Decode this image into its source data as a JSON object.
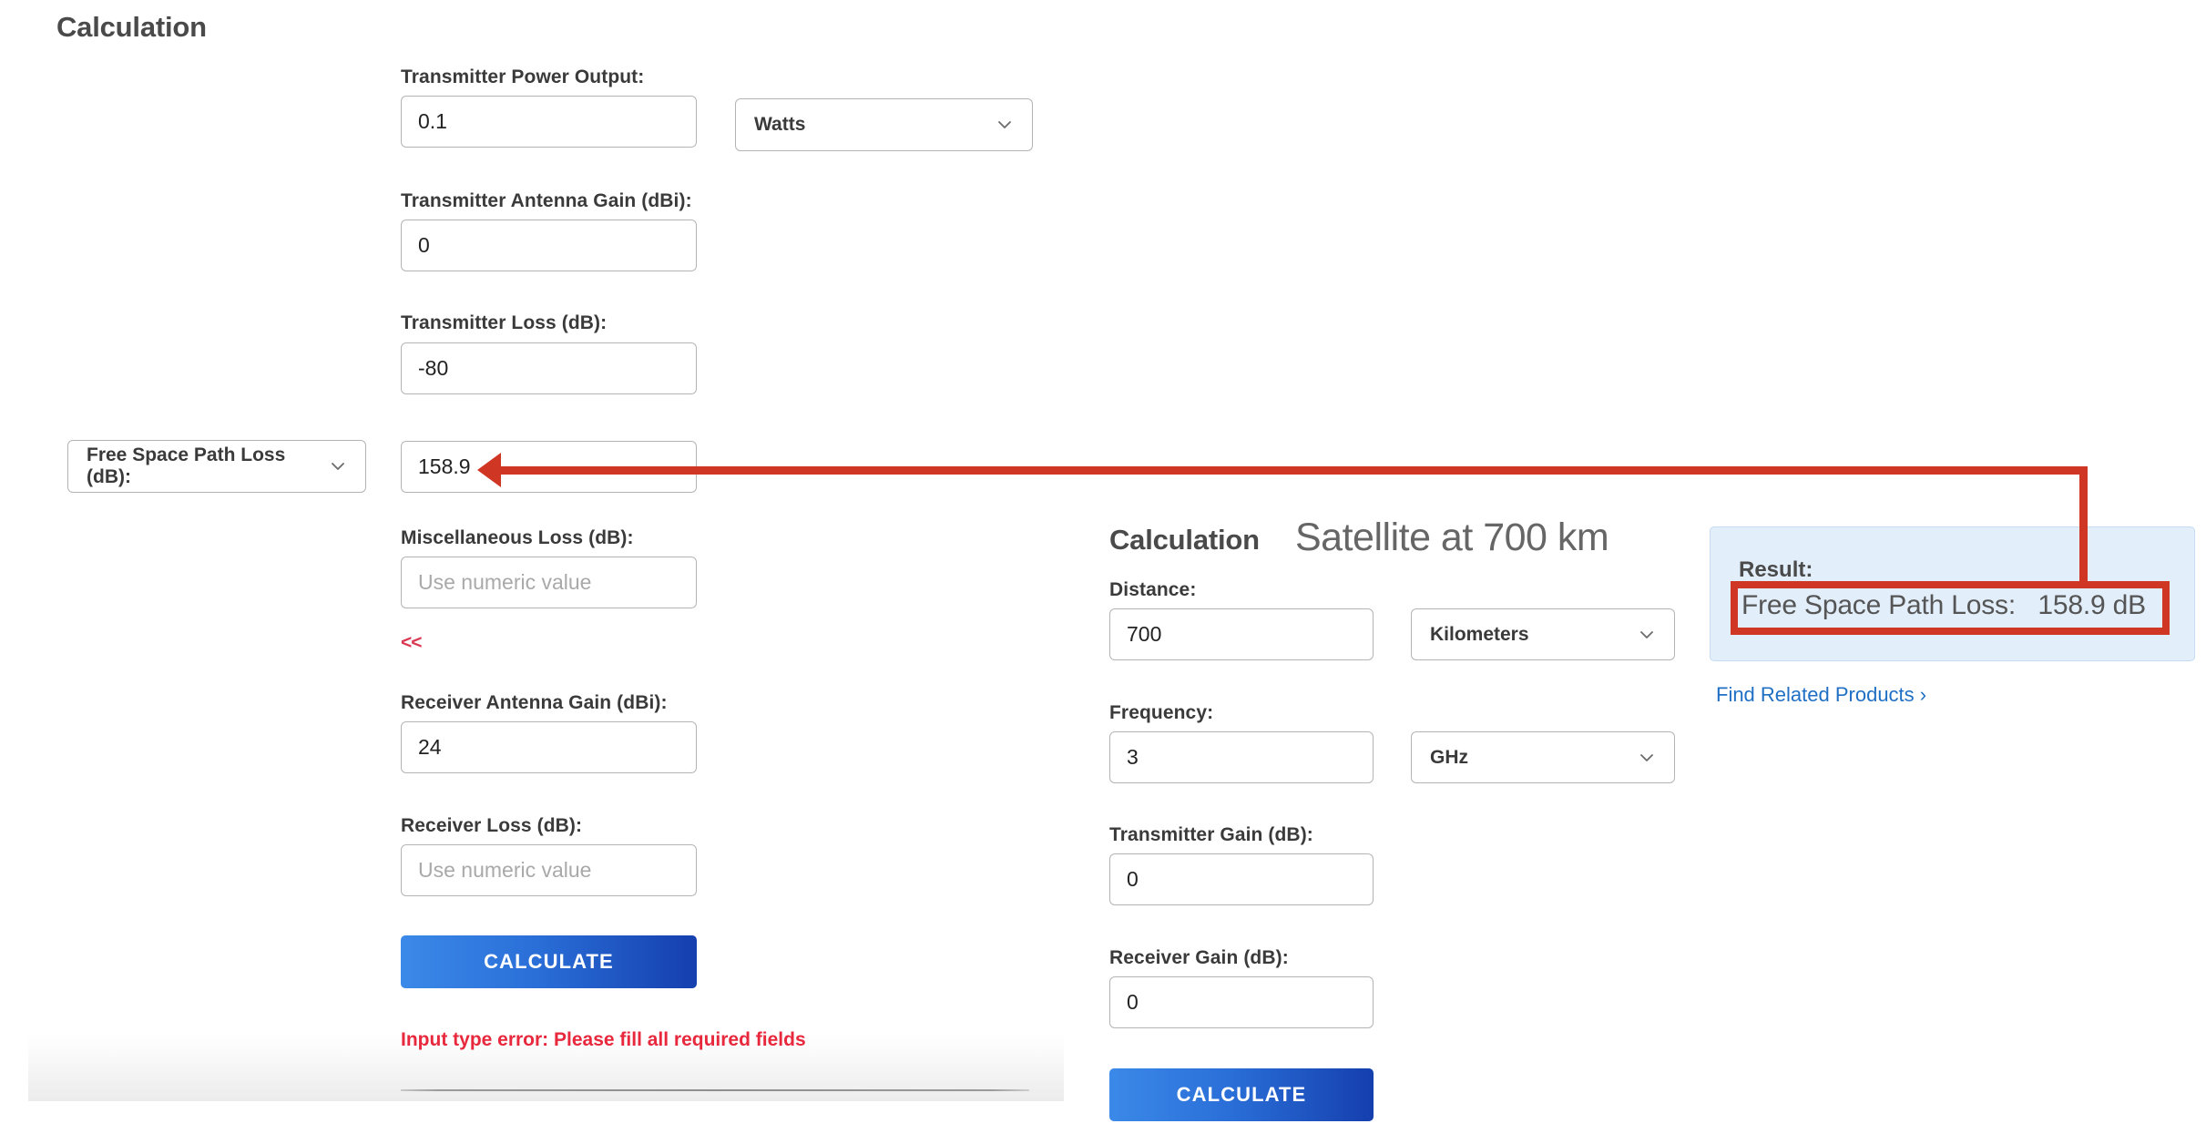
{
  "background_form": {
    "title": "Calculation",
    "fields": [
      {
        "label": "Transmitter Power Output:",
        "value": "0.1",
        "placeholder": "",
        "unit": "Watts"
      },
      {
        "label": "Transmitter Antenna Gain (dBi):",
        "value": "0",
        "placeholder": ""
      },
      {
        "label": "Transmitter Loss (dB):",
        "value": "-80",
        "placeholder": ""
      }
    ],
    "loss_row": {
      "select_label": "Free Space Path Loss (dB):",
      "value": "158.9"
    },
    "misc_loss": {
      "label": "Miscellaneous Loss (dB):",
      "value": "",
      "placeholder": "Use numeric value"
    },
    "collapse_label": "<<",
    "receiver_gain": {
      "label": "Receiver Antenna Gain (dBi):",
      "value": "24",
      "placeholder": ""
    },
    "receiver_loss": {
      "label": "Receiver Loss (dB):",
      "value": "",
      "placeholder": "Use numeric value"
    },
    "calculate_label": "CALCULATE",
    "error_message": "Input type error: Please fill all required fields"
  },
  "overlay_form": {
    "kicker": "Calculation",
    "title": "Satellite at 700 km",
    "distance": {
      "label": "Distance:",
      "value": "700",
      "placeholder": "",
      "unit": "Kilometers"
    },
    "frequency": {
      "label": "Frequency:",
      "value": "3",
      "placeholder": "",
      "unit": "GHz"
    },
    "transmitter_gain": {
      "label": "Transmitter Gain (dB):",
      "value": "0",
      "placeholder": ""
    },
    "receiver_gain": {
      "label": "Receiver Gain (dB):",
      "value": "0",
      "placeholder": ""
    },
    "calculate_label": "CALCULATE"
  },
  "result_panel": {
    "label": "Result:",
    "value": "Free Space Path Loss:   158.9 dB",
    "find_products_label": "Find Related Products ›"
  },
  "colors": {
    "annotation_red": "#cf3724",
    "result_bg": "#e2eefa",
    "link_blue": "#1f6fc4",
    "error_red": "#e8283c",
    "button_gradient_start": "#3b89e8",
    "button_gradient_end": "#153fae"
  }
}
